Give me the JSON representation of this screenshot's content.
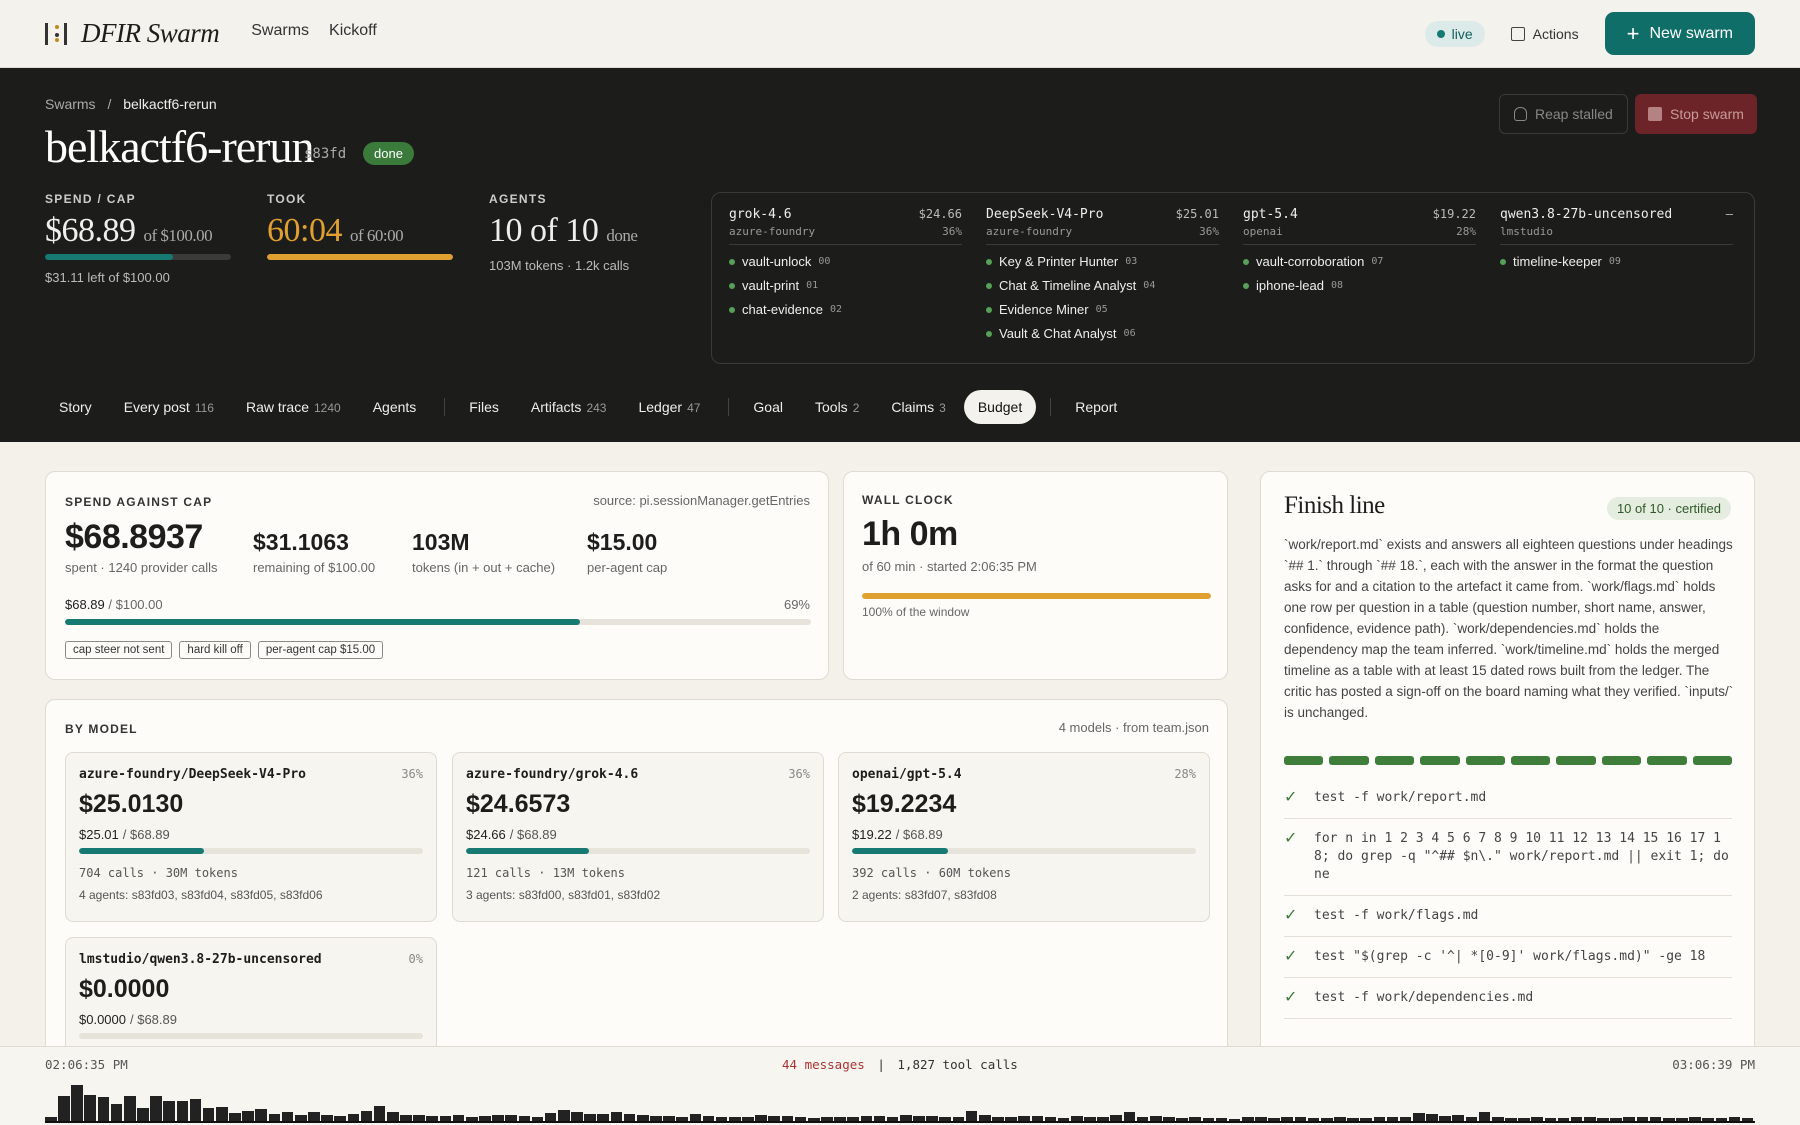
{
  "topbar": {
    "app_name": "DFIR Swarm",
    "nav": [
      "Swarms",
      "Kickoff"
    ],
    "live_label": "live",
    "actions_label": "Actions",
    "new_swarm_label": "New swarm"
  },
  "header": {
    "breadcrumb_root": "Swarms",
    "breadcrumb_sep": "/",
    "breadcrumb_current": "belkactf6-rerun",
    "title": "belkactf6-rerun",
    "short_id": "s83fd",
    "status": "done",
    "reap_label": "Reap stalled",
    "stop_label": "Stop swarm",
    "spend": {
      "label": "SPEND / CAP",
      "value": "$68.89",
      "of": "of $100.00",
      "sub": "$31.11 left of $100.00",
      "fraction": 0.689,
      "color": "#167a72"
    },
    "took": {
      "label": "TOOK",
      "value": "60:04",
      "of": "of 60:00",
      "fraction": 1.0,
      "color": "#e0a030"
    },
    "agents": {
      "label": "AGENTS",
      "value": "10 of 10",
      "of": "done",
      "sub": "103M tokens · 1.2k calls"
    }
  },
  "team": [
    {
      "model": "grok-4.6",
      "provider": "azure-foundry",
      "cost": "$24.66",
      "pct": "36%",
      "agents": [
        {
          "name": "vault-unlock",
          "num": "00"
        },
        {
          "name": "vault-print",
          "num": "01"
        },
        {
          "name": "chat-evidence",
          "num": "02"
        }
      ]
    },
    {
      "model": "DeepSeek-V4-Pro",
      "provider": "azure-foundry",
      "cost": "$25.01",
      "pct": "36%",
      "agents": [
        {
          "name": "Key & Printer Hunter",
          "num": "03"
        },
        {
          "name": "Chat & Timeline Analyst",
          "num": "04"
        },
        {
          "name": "Evidence Miner",
          "num": "05"
        },
        {
          "name": "Vault & Chat Analyst",
          "num": "06"
        }
      ]
    },
    {
      "model": "gpt-5.4",
      "provider": "openai",
      "cost": "$19.22",
      "pct": "28%",
      "agents": [
        {
          "name": "vault-corroboration",
          "num": "07"
        },
        {
          "name": "iphone-lead",
          "num": "08"
        }
      ]
    },
    {
      "model": "qwen3.8-27b-uncensored",
      "provider": "lmstudio",
      "cost": "–",
      "pct": "",
      "agents": [
        {
          "name": "timeline-keeper",
          "num": "09"
        }
      ]
    }
  ],
  "tabs": [
    {
      "label": "Story",
      "count": ""
    },
    {
      "label": "Every post",
      "count": "116"
    },
    {
      "label": "Raw trace",
      "count": "1240"
    },
    {
      "label": "Agents",
      "count": ""
    },
    {
      "label": "Files",
      "count": ""
    },
    {
      "label": "Artifacts",
      "count": "243"
    },
    {
      "label": "Ledger",
      "count": "47"
    },
    {
      "label": "Goal",
      "count": ""
    },
    {
      "label": "Tools",
      "count": "2"
    },
    {
      "label": "Claims",
      "count": "3"
    },
    {
      "label": "Budget",
      "count": ""
    },
    {
      "label": "Report",
      "count": ""
    }
  ],
  "spend_card": {
    "caption": "SPEND AGAINST CAP",
    "source": "source: pi.sessionManager.getEntries",
    "spent": "$68.8937",
    "spent_sub": "spent · 1240 provider calls",
    "remaining": "$31.1063",
    "remaining_sub": "remaining of $100.00",
    "tokens": "103M",
    "tokens_sub": "tokens (in + out + cache)",
    "per_agent": "$15.00",
    "per_agent_sub": "per-agent cap",
    "progress_label": "$68.89",
    "progress_of": "/ $100.00",
    "progress_pct": "69%",
    "progress_fraction": 0.69,
    "chips": [
      "cap steer not sent",
      "hard kill off",
      "per-agent cap $15.00"
    ]
  },
  "wall_clock": {
    "caption": "WALL CLOCK",
    "value": "1h 0m",
    "sub": "of 60 min · started 2:06:35 PM",
    "fraction": 1.0,
    "note": "100% of the window"
  },
  "by_model": {
    "caption": "BY MODEL",
    "meta": "4 models · from team.json",
    "models": [
      {
        "name": "azure-foundry/DeepSeek-V4-Pro",
        "pct": "36%",
        "value": "$25.0130",
        "ratio_a": "$25.01",
        "ratio_b": "/ $68.89",
        "fraction": 0.363,
        "tokens": "704 calls · 30M tokens",
        "agents": "4 agents: s83fd03, s83fd04, s83fd05, s83fd06"
      },
      {
        "name": "azure-foundry/grok-4.6",
        "pct": "36%",
        "value": "$24.6573",
        "ratio_a": "$24.66",
        "ratio_b": "/ $68.89",
        "fraction": 0.358,
        "tokens": "121 calls · 13M tokens",
        "agents": "3 agents: s83fd00, s83fd01, s83fd02"
      },
      {
        "name": "openai/gpt-5.4",
        "pct": "28%",
        "value": "$19.2234",
        "ratio_a": "$19.22",
        "ratio_b": "/ $68.89",
        "fraction": 0.279,
        "tokens": "392 calls · 60M tokens",
        "agents": "2 agents: s83fd07, s83fd08"
      },
      {
        "name": "lmstudio/qwen3.8-27b-uncensored",
        "pct": "0%",
        "value": "$0.0000",
        "ratio_a": "$0.0000",
        "ratio_b": "/ $68.89",
        "fraction": 0,
        "tokens": "",
        "agents": ""
      }
    ]
  },
  "finish": {
    "title": "Finish line",
    "badge": "10 of 10 · certified",
    "text": "`work/report.md` exists and answers all eighteen questions under headings `## 1.` through `## 18.`, each with the answer in the format the question asks for and a citation to the artefact it came from. `work/flags.md` holds one row per question in a table (question number, short name, answer, confidence, evidence path). `work/dependencies.md` holds the dependency map the team inferred. `work/timeline.md` holds the merged timeline as a table with at least 15 dated rows built from the ledger. The critic has posted a sign-off on the board naming what they verified. `inputs/` is unchanged.",
    "segments": 10,
    "checks": [
      "test -f work/report.md",
      "for n in 1 2 3 4 5 6 7 8 9 10 11 12 13 14 15 16 17 18; do grep -q \"^## $n\\.\" work/report.md || exit 1; done",
      "test -f work/flags.md",
      "test \"$(grep -c '^| *[0-9]' work/flags.md)\" -ge 18",
      "test -f work/dependencies.md"
    ]
  },
  "timeline": {
    "start": "02:06:35 PM",
    "end": "03:06:39 PM",
    "messages": "44 messages",
    "sep": "|",
    "tool_calls": "1,827 tool calls",
    "activity": [
      4,
      24,
      35,
      25,
      23,
      17,
      24,
      13,
      24,
      19,
      19,
      21,
      13,
      14,
      8,
      10,
      12,
      7,
      9,
      6,
      9,
      6,
      5,
      7,
      10,
      15,
      9,
      6,
      6,
      5,
      5,
      6,
      4,
      5,
      6,
      6,
      5,
      4,
      8,
      11,
      9,
      7,
      7,
      9,
      7,
      6,
      5,
      5,
      4,
      7,
      5,
      4,
      4,
      4,
      6,
      5,
      5,
      4,
      3,
      4,
      4,
      4,
      5,
      5,
      4,
      6,
      5,
      5,
      4,
      4,
      10,
      6,
      4,
      4,
      5,
      5,
      4,
      3,
      5,
      4,
      4,
      6,
      9,
      4,
      5,
      4,
      3,
      4,
      3,
      3,
      2,
      4,
      4,
      3,
      4,
      4,
      3,
      3,
      4,
      3,
      3,
      4,
      4,
      4,
      8,
      7,
      5,
      6,
      4,
      9,
      4,
      3,
      3,
      4,
      3,
      3,
      4,
      4,
      3,
      3,
      4,
      4,
      4,
      3,
      3,
      4,
      3,
      3,
      4,
      3
    ]
  }
}
